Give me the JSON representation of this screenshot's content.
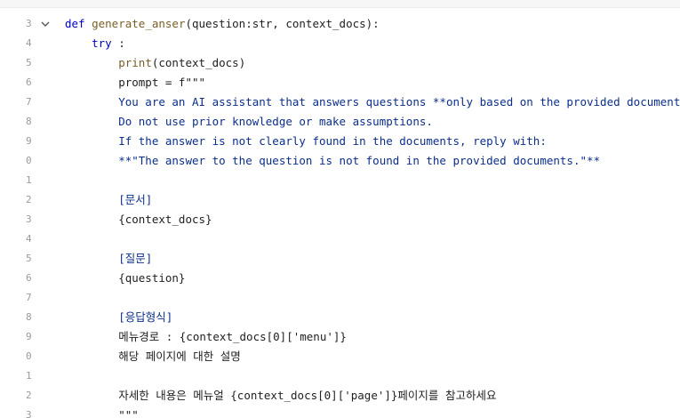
{
  "gutter": {
    "line_numbers": [
      "3",
      "4",
      "5",
      "6",
      "7",
      "8",
      "9",
      "0",
      "1",
      "2",
      "3",
      "4",
      "5",
      "6",
      "7",
      "8",
      "9",
      "0",
      "1",
      "2",
      "3"
    ]
  },
  "code": {
    "lines": [
      {
        "parts": [
          {
            "t": "def ",
            "c": "kw"
          },
          {
            "t": "generate_anser",
            "c": "fn"
          },
          {
            "t": "(question:str, context_docs):",
            "c": "plain"
          }
        ]
      },
      {
        "parts": [
          {
            "t": "    ",
            "c": "plain"
          },
          {
            "t": "try",
            "c": "kw"
          },
          {
            "t": " :",
            "c": "plain"
          }
        ]
      },
      {
        "parts": [
          {
            "t": "        ",
            "c": "plain"
          },
          {
            "t": "print",
            "c": "fn"
          },
          {
            "t": "(context_docs)",
            "c": "plain"
          }
        ]
      },
      {
        "parts": [
          {
            "t": "        prompt = f\"\"\"",
            "c": "plain"
          }
        ]
      },
      {
        "parts": [
          {
            "t": "        You are an AI assistant that answers questions **only based on the provided documents**.",
            "c": "str"
          }
        ]
      },
      {
        "parts": [
          {
            "t": "        Do not use prior knowledge or make assumptions.",
            "c": "str"
          }
        ]
      },
      {
        "parts": [
          {
            "t": "        If the answer is not clearly found in the documents, reply with:",
            "c": "str"
          }
        ]
      },
      {
        "parts": [
          {
            "t": "        **\"The answer to the question is not found in the provided documents.\"**",
            "c": "str"
          }
        ]
      },
      {
        "parts": [
          {
            "t": "",
            "c": "plain"
          }
        ]
      },
      {
        "parts": [
          {
            "t": "        [문서]",
            "c": "str"
          }
        ]
      },
      {
        "parts": [
          {
            "t": "        {context_docs}",
            "c": "plain"
          }
        ]
      },
      {
        "parts": [
          {
            "t": "",
            "c": "plain"
          }
        ]
      },
      {
        "parts": [
          {
            "t": "        [질문]",
            "c": "str"
          }
        ]
      },
      {
        "parts": [
          {
            "t": "        {question}",
            "c": "plain"
          }
        ]
      },
      {
        "parts": [
          {
            "t": "",
            "c": "plain"
          }
        ]
      },
      {
        "parts": [
          {
            "t": "        [응답형식]",
            "c": "str"
          }
        ]
      },
      {
        "parts": [
          {
            "t": "        메뉴경로 : {context_docs[0]['menu']}",
            "c": "plain"
          }
        ]
      },
      {
        "parts": [
          {
            "t": "        해당 페이지에 대한 설명",
            "c": "plain"
          }
        ]
      },
      {
        "parts": [
          {
            "t": "",
            "c": "plain"
          }
        ]
      },
      {
        "parts": [
          {
            "t": "        자세한 내용은 메뉴얼 {context_docs[0]['page']}페이지를 참고하세요",
            "c": "plain"
          }
        ]
      },
      {
        "parts": [
          {
            "t": "        \"\"\"",
            "c": "plain"
          }
        ]
      }
    ]
  },
  "icons": {
    "fold": "chevron-down-icon"
  },
  "colors": {
    "keyword": "#0000cc",
    "function": "#795e26",
    "string": "#0b2e8a",
    "text": "#1f1f1f",
    "line_number": "#9a9a9a"
  }
}
